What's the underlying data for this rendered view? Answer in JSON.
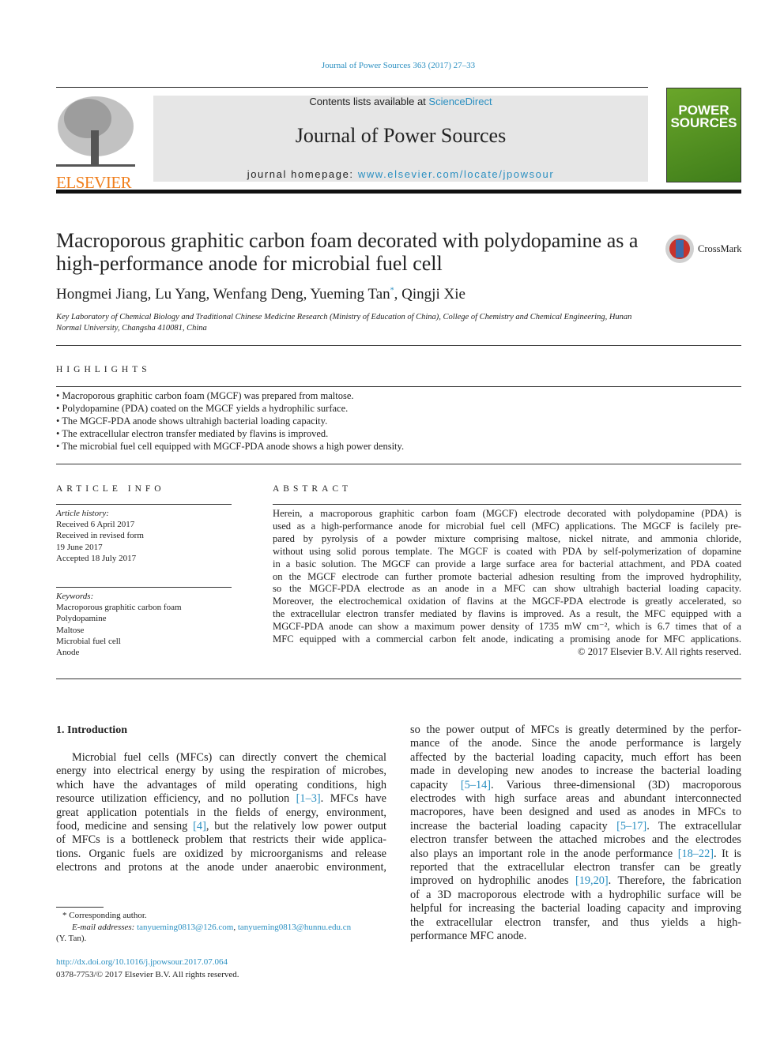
{
  "header": {
    "citation": "Journal of Power Sources 363 (2017) 27–33",
    "contents_prefix": "Contents lists available at ",
    "contents_link": "ScienceDirect",
    "journal_title": "Journal of Power Sources",
    "homepage_prefix": "journal homepage: ",
    "homepage_link": "www.elsevier.com/locate/jpowsour",
    "publisher_logo": "ELSEVIER",
    "cover_text": "POWER SOURCES",
    "link_color": "#2a8fc1",
    "publisher_color": "#f07f1d"
  },
  "article": {
    "title": "Macroporous graphitic carbon foam decorated with polydopamine as a high-performance anode for microbial fuel cell",
    "crossmark": "CrossMark",
    "authors": "Hongmei Jiang, Lu Yang, Wenfang Deng, Yueming Tan",
    "author_mark": "*",
    "authors_tail": ", Qingji Xie",
    "affiliation": "Key Laboratory of Chemical Biology and Traditional Chinese Medicine Research (Ministry of Education of China), College of Chemistry and Chemical Engineering, Hunan Normal University, Changsha 410081, China"
  },
  "highlights": {
    "heading": "HIGHLIGHTS",
    "items": [
      "Macroporous graphitic carbon foam (MGCF) was prepared from maltose.",
      "Polydopamine (PDA) coated on the MGCF yields a hydrophilic surface.",
      "The MGCF-PDA anode shows ultrahigh bacterial loading capacity.",
      "The extracellular electron transfer mediated by flavins is improved.",
      "The microbial fuel cell equipped with MGCF-PDA anode shows a high power density."
    ]
  },
  "article_info": {
    "heading": "ARTICLE INFO",
    "history_label": "Article history:",
    "history": [
      "Received 6 April 2017",
      "Received in revised form",
      "19 June 2017",
      "Accepted 18 July 2017"
    ],
    "keywords_label": "Keywords:",
    "keywords": [
      "Macroporous graphitic carbon foam",
      "Polydopamine",
      "Maltose",
      "Microbial fuel cell",
      "Anode"
    ]
  },
  "abstract": {
    "heading": "ABSTRACT",
    "lines": [
      "Herein, a macroporous graphitic carbon foam (MGCF) electrode decorated with polydopamine (PDA) is",
      "used as a high-performance anode for microbial fuel cell (MFC) applications. The MGCF is facilely pre-",
      "pared by pyrolysis of a powder mixture comprising maltose, nickel nitrate, and ammonia chloride,",
      "without using solid porous template. The MGCF is coated with PDA by self-polymerization of dopamine",
      "in a basic solution. The MGCF can provide a large surface area for bacterial attachment, and PDA coated",
      "on the MGCF electrode can further promote bacterial adhesion resulting from the improved hydrophility,",
      "so the MGCF-PDA electrode as an anode in a MFC can show ultrahigh bacterial loading capacity.",
      "Moreover, the electrochemical oxidation of flavins at the MGCF-PDA electrode is greatly accelerated, so",
      "the extracellular electron transfer mediated by flavins is improved. As a result, the MFC equipped with a",
      "MGCF-PDA anode can show a maximum power density of 1735 mW cm⁻², which is 6.7 times that of a",
      "MFC equipped with a commercial carbon felt anode, indicating a promising anode for MFC applications."
    ],
    "copyright": "© 2017 Elsevier B.V. All rights reserved."
  },
  "introduction": {
    "heading": "1.  Introduction",
    "left_lines": [
      "Microbial fuel cells (MFCs) can directly convert the chemical",
      "energy into electrical energy by using the respiration of microbes,",
      "which have the advantages of mild operating conditions, high",
      "resource utilization efficiency, and no pollution [1–3]. MFCs have",
      "great application potentials in the fields of energy, environment,",
      "food, medicine and sensing [4], but the relatively low power output",
      "of MFCs is a bottleneck problem that restricts their wide applica-",
      "tions. Organic fuels are oxidized by microorganisms and release",
      "electrons and protons at the anode under anaerobic environment,"
    ],
    "right_lines": [
      "so the power output of MFCs is greatly determined by the perfor-",
      "mance of the anode. Since the anode performance is largely",
      "affected by the bacterial loading capacity, much effort has been",
      "made in developing new anodes to increase the bacterial loading",
      "capacity [5–14]. Various three-dimensional (3D) macroporous",
      "electrodes with high surface areas and abundant interconnected",
      "macropores, have been designed and used as anodes in MFCs to",
      "increase the bacterial loading capacity [5–17]. The extracellular",
      "electron transfer between the attached microbes and the electrodes",
      "also plays an important role in the anode performance [18–22]. It is",
      "reported that the extracellular electron transfer can be greatly",
      "improved on hydrophilic anodes [19,20]. Therefore, the fabrication",
      "of a 3D macroporous electrode with a hydrophilic surface will be",
      "helpful for increasing the bacterial loading capacity and improving",
      "the extracellular electron transfer, and thus yields a high-",
      "performance MFC anode."
    ]
  },
  "footnote": {
    "corresponding": "* Corresponding author.",
    "email_label": "E-mail addresses:",
    "email1": "tanyueming0813@126.com",
    "email2": "tanyueming0813@hunnu.edu.cn",
    "name": "(Y. Tan).",
    "doi": "http://dx.doi.org/10.1016/j.jpowsour.2017.07.064",
    "issn": "0378-7753/© 2017 Elsevier B.V. All rights reserved."
  }
}
